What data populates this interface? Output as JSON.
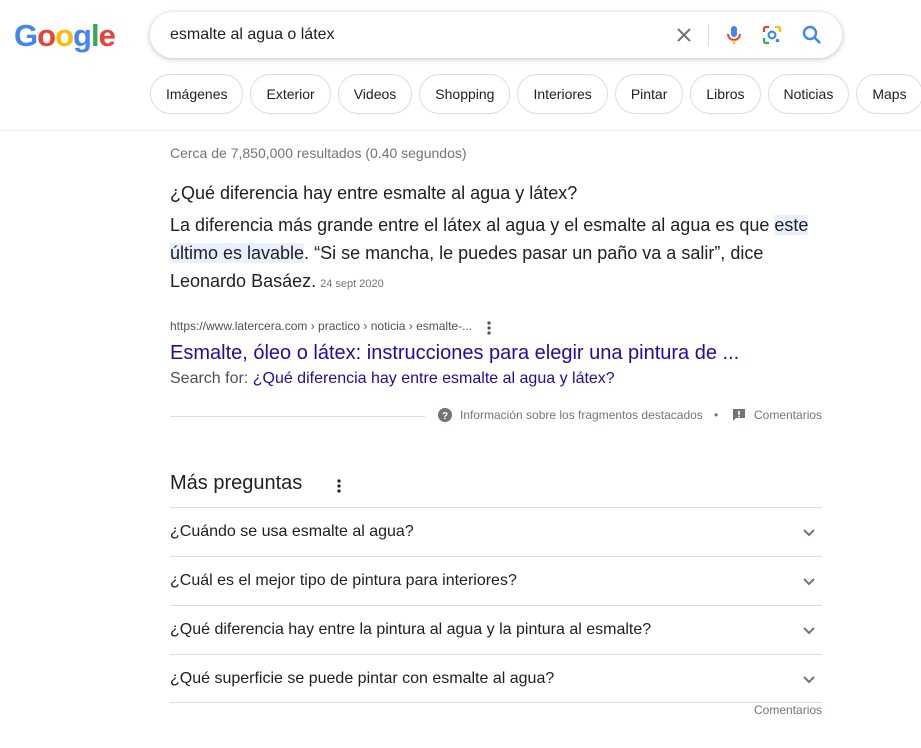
{
  "logo": {
    "letters": [
      "G",
      "o",
      "o",
      "g",
      "l",
      "e"
    ],
    "colors": [
      "#4285F4",
      "#EA4335",
      "#FBBC05",
      "#4285F4",
      "#34A853",
      "#EA4335"
    ]
  },
  "search": {
    "query": "esmalte al agua o látex"
  },
  "chips": [
    "Imágenes",
    "Exterior",
    "Videos",
    "Shopping",
    "Interiores",
    "Pintar",
    "Libros",
    "Noticias",
    "Maps"
  ],
  "stats": "Cerca de 7,850,000 resultados (0.40 segundos)",
  "featured_snippet": {
    "question": "¿Qué diferencia hay entre esmalte al agua y látex?",
    "answer_before": "La diferencia más grande entre el látex al agua y el esmalte al agua es que ",
    "answer_highlight": "este último es lavable",
    "answer_after": ". “Si se mancha, le puedes pasar un paño va a salir”, dice Leonardo Basáez.",
    "date": "24 sept 2020",
    "cite": "https://www.latercera.com › practico › noticia › esmalte-...",
    "title": "Esmalte, óleo o látex: instrucciones para elegir una pintura de ...",
    "search_for_label": "Search for:",
    "search_for_link": "¿Qué diferencia hay entre esmalte al agua y látex?",
    "about_label": "Información sobre los fragmentos destacados",
    "bullet": "•",
    "feedback_label": "Comentarios"
  },
  "paa": {
    "title": "Más preguntas",
    "questions": [
      "¿Cuándo se usa esmalte al agua?",
      "¿Cuál es el mejor tipo de pintura para interiores?",
      "¿Qué diferencia hay entre la pintura al agua y la pintura al esmalte?",
      "¿Qué superficie se puede pintar con esmalte al agua?"
    ],
    "feedback_label": "Comentarios"
  },
  "icons": {
    "clear": "close-icon",
    "mic": "microphone-icon",
    "lens": "google-lens-icon",
    "search": "search-icon",
    "kebab": "more-vert-icon",
    "help": "help-circle-icon",
    "feedback": "feedback-icon",
    "chevron": "chevron-down-icon"
  },
  "colors": {
    "link": "#1a0dab",
    "highlight": "#e8f0fe",
    "muted": "#70757a"
  }
}
